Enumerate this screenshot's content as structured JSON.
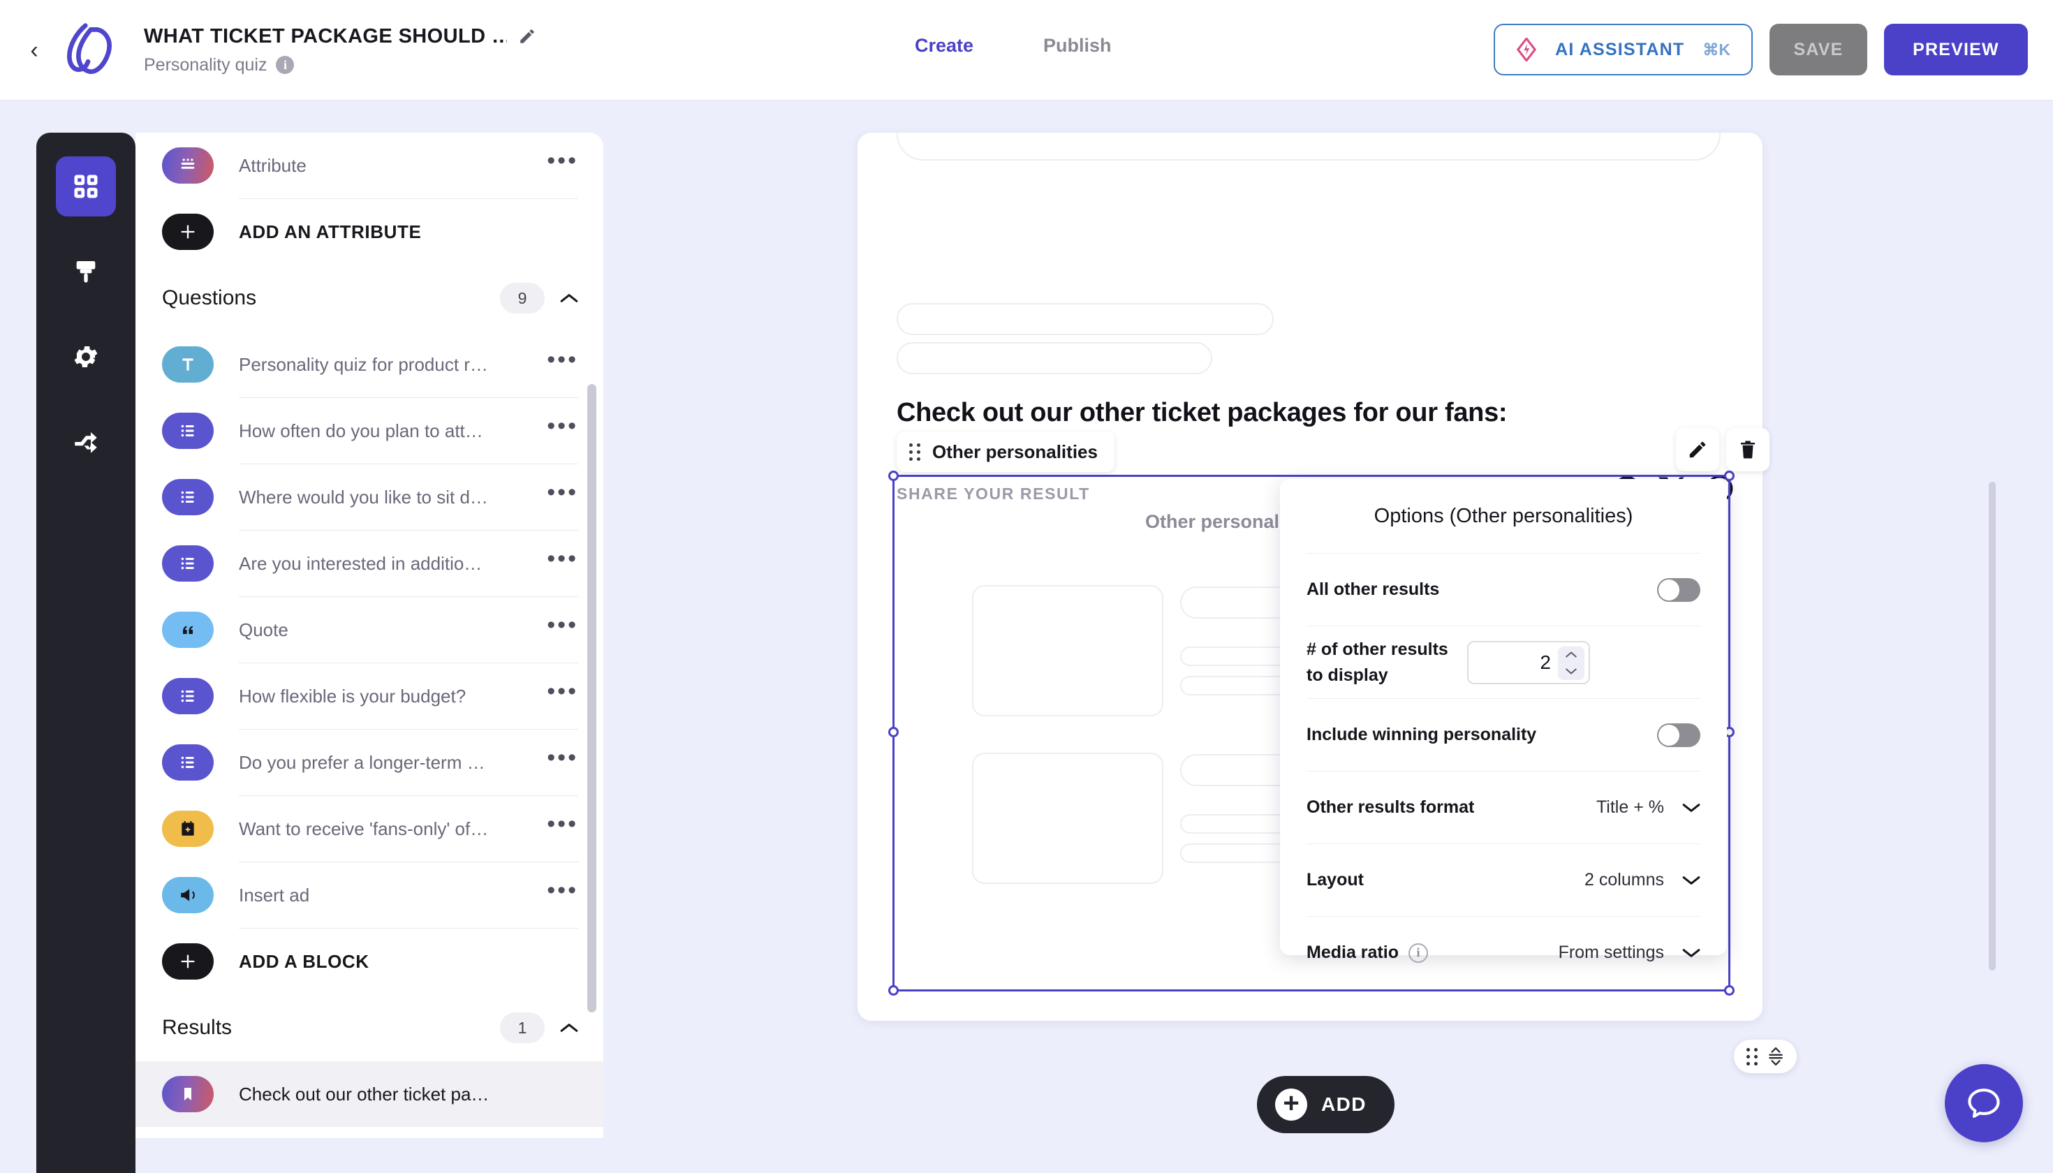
{
  "header": {
    "back_icon": "chevron-left-icon",
    "logo_icon": "brand-logo-icon",
    "title": "WHAT TICKET PACKAGE SHOULD …",
    "edit_icon": "pencil-icon",
    "subtitle": "Personality quiz",
    "info_icon": "info-icon",
    "tabs": [
      {
        "label": "Create",
        "active": true
      },
      {
        "label": "Publish",
        "active": false
      }
    ],
    "ai_button": {
      "label": "AI ASSISTANT",
      "shortcut": "⌘K",
      "icon": "ai-diamond-icon"
    },
    "save_label": "SAVE",
    "preview_label": "PREVIEW"
  },
  "rail": {
    "items": [
      {
        "icon": "grid-blocks-icon",
        "name": "blocks",
        "active": true
      },
      {
        "icon": "paint-brush-icon",
        "name": "design",
        "active": false
      },
      {
        "icon": "gear-icon",
        "name": "settings",
        "active": false
      },
      {
        "icon": "share-branch-icon",
        "name": "logic",
        "active": false
      }
    ]
  },
  "panel": {
    "attribute_row": {
      "label": "Attribute",
      "icon": "attribute-icon",
      "menu": "•••"
    },
    "add_attribute_label": "ADD AN ATTRIBUTE",
    "questions_section": {
      "title": "Questions",
      "count": "9",
      "collapse_icon": "chevron-up-icon"
    },
    "questions": [
      {
        "label": "Personality quiz for product r…",
        "icon": "text-block-icon",
        "kind": "text"
      },
      {
        "label": "How often do you plan to att…",
        "icon": "choice-block-icon",
        "kind": "choice"
      },
      {
        "label": "Where would you like to sit d…",
        "icon": "choice-block-icon",
        "kind": "choice"
      },
      {
        "label": "Are you interested in additio…",
        "icon": "choice-block-icon",
        "kind": "choice"
      },
      {
        "label": "Quote",
        "icon": "quote-block-icon",
        "kind": "quote"
      },
      {
        "label": "How flexible is your budget?",
        "icon": "choice-block-icon",
        "kind": "choice"
      },
      {
        "label": "Do you prefer a longer-term …",
        "icon": "choice-block-icon",
        "kind": "choice"
      },
      {
        "label": "Want to receive 'fans-only' of…",
        "icon": "form-block-icon",
        "kind": "form"
      },
      {
        "label": "Insert ad",
        "icon": "ad-block-icon",
        "kind": "ad"
      }
    ],
    "add_block_label": "ADD A BLOCK",
    "results_section": {
      "title": "Results",
      "count": "1",
      "collapse_icon": "chevron-up-icon"
    },
    "results": [
      {
        "label": "Check out our other ticket pa…",
        "icon": "result-block-icon",
        "kind": "result",
        "selected": true
      }
    ],
    "menu_glyph": "•••"
  },
  "canvas": {
    "result_heading": "Check out our other ticket packages for our fans:",
    "share_label": "SHARE YOUR RESULT",
    "share_icons": [
      "facebook-icon",
      "x-twitter-icon",
      "whatsapp-icon"
    ],
    "block_tab_label": "Other personalities",
    "block_title": "Other personal",
    "edit_icon": "pencil-icon",
    "delete_icon": "trash-icon",
    "add_button_label": "ADD",
    "drag_handle_icon": "drag-reorder-icon",
    "chat_icon": "chat-bubble-icon"
  },
  "options": {
    "title": "Options (Other personalities)",
    "rows": [
      {
        "label": "All other results",
        "type": "toggle",
        "value": "off"
      },
      {
        "label": "# of other results to display",
        "type": "number",
        "value": "2"
      },
      {
        "label": "Include winning personality",
        "type": "toggle",
        "value": "off"
      },
      {
        "label": "Other results format",
        "type": "select",
        "value": "Title + %"
      },
      {
        "label": "Layout",
        "type": "select",
        "value": "2 columns"
      },
      {
        "label": "Media ratio",
        "type": "select",
        "value": "From settings",
        "info_icon": "info-icon"
      }
    ]
  },
  "colors": {
    "accent": "#4a41c8",
    "canvas_bg": "#eceefc",
    "rail_bg": "#23232c",
    "toggle_off": "#8d8d93"
  }
}
